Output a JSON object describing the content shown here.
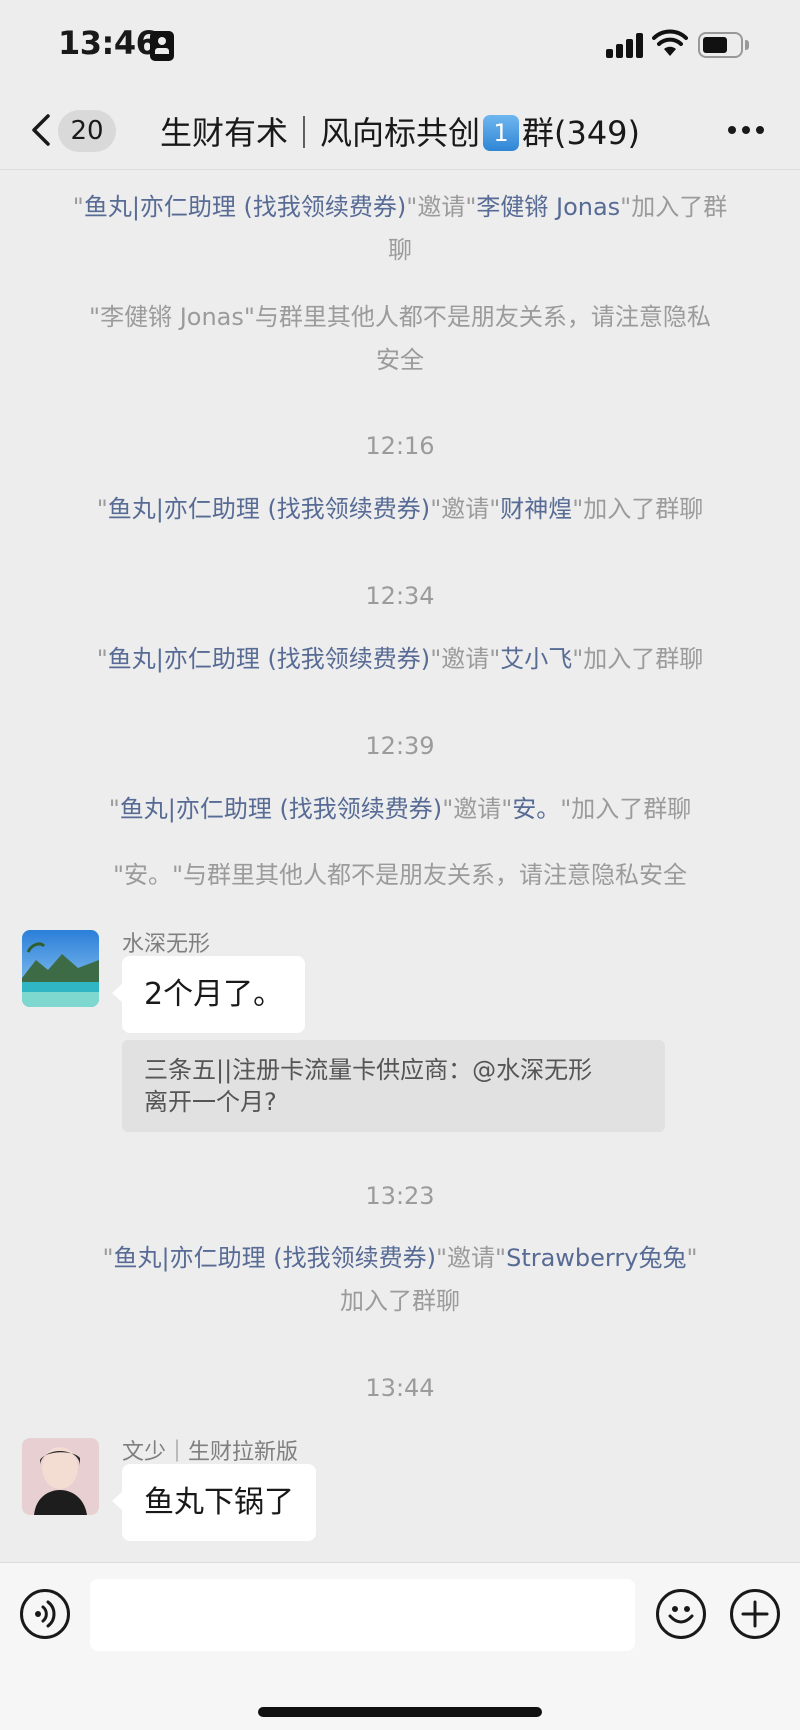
{
  "status_bar": {
    "time": "13:46"
  },
  "nav": {
    "back_count": "20",
    "title_prefix": "生财有术｜风向标共创",
    "title_badge": "1",
    "title_suffix": "群(349)"
  },
  "messages": {
    "sys1": {
      "q1": "\"",
      "inviter": "鱼丸|亦仁助理 (找我领续费券)",
      "mid": "\"邀请\"",
      "invitee": "李健锵 Jonas",
      "end": "\"加入了群聊"
    },
    "sys2": "\"李健锵 Jonas\"与群里其他人都不是朋友关系，请注意隐私安全",
    "ts1": "12:16",
    "sys3": {
      "q1": "\"",
      "inviter": "鱼丸|亦仁助理 (找我领续费券)",
      "mid": "\"邀请\"",
      "invitee": "财神煌",
      "end": "\"加入了群聊"
    },
    "ts2": "12:34",
    "sys4": {
      "q1": "\"",
      "inviter": "鱼丸|亦仁助理 (找我领续费券)",
      "mid": "\"邀请\"",
      "invitee": "艾小飞",
      "end": "\"加入了群聊"
    },
    "ts3": "12:39",
    "sys5": {
      "q1": "\"",
      "inviter": "鱼丸|亦仁助理 (找我领续费券)",
      "mid": "\"邀请\"",
      "invitee": "安。",
      "end": "\"加入了群聊"
    },
    "sys6": "\"安。\"与群里其他人都不是朋友关系，请注意隐私安全",
    "msg1": {
      "sender": "水深无形",
      "text": "2个月了。",
      "quote_line1": "三条五||注册卡流量卡供应商：@水深无形",
      "quote_line2": "离开一个月?"
    },
    "ts4": "13:23",
    "sys7": {
      "q1": "\"",
      "inviter": "鱼丸|亦仁助理 (找我领续费券)",
      "mid": "\"邀请\"",
      "invitee": "Strawberry兔兔",
      "end": "\"",
      "line2": "加入了群聊"
    },
    "ts5": "13:44",
    "msg2": {
      "sender": "文少｜生财拉新版",
      "text": "鱼丸下锅了"
    }
  },
  "colors": {
    "link": "#576b95",
    "system_text": "#9b9b9b",
    "background": "#ededed",
    "bubble": "#ffffff"
  },
  "icons": [
    "back-chevron-icon",
    "more-dots-icon",
    "voice-icon",
    "emoji-icon",
    "plus-icon",
    "signal-icon",
    "wifi-icon",
    "battery-icon"
  ]
}
